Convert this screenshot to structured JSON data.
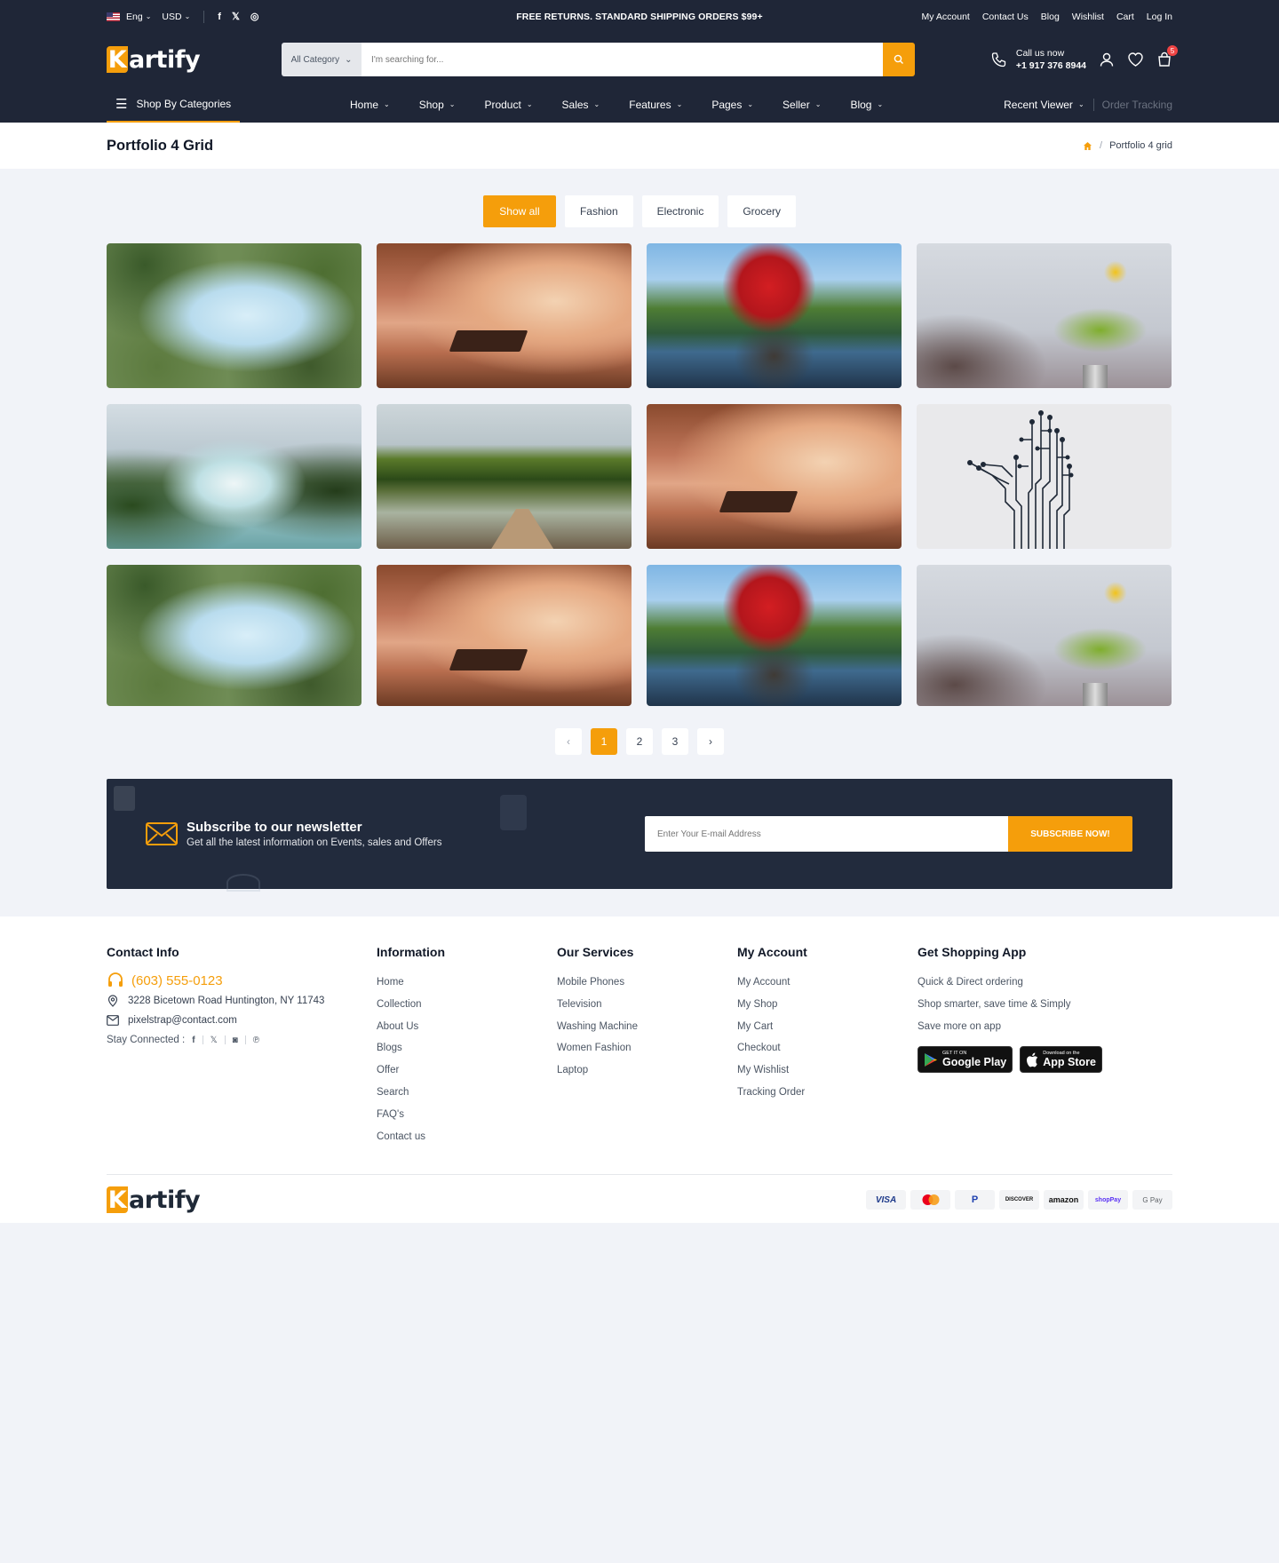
{
  "topbar": {
    "language": "Eng",
    "currency": "USD",
    "promo": "FREE RETURNS. STANDARD SHIPPING ORDERS $99+",
    "links": [
      "My Account",
      "Contact Us",
      "Blog",
      "Wishlist",
      "Cart",
      "Log In"
    ]
  },
  "header": {
    "logo_first": "K",
    "logo_rest": "artify",
    "search_category": "All Category",
    "search_placeholder": "I'm searching for...",
    "call_label": "Call us now",
    "call_number": "+1 917 376 8944",
    "cart_count": "5"
  },
  "nav": {
    "shop_by": "Shop By Categories",
    "items": [
      "Home",
      "Shop",
      "Product",
      "Sales",
      "Features",
      "Pages",
      "Seller",
      "Blog"
    ],
    "recent": "Recent Viewer",
    "tracking": "Order Tracking"
  },
  "page": {
    "title": "Portfolio 4 Grid",
    "crumb": "Portfolio 4 grid"
  },
  "filters": [
    "Show all",
    "Fashion",
    "Electronic",
    "Grocery"
  ],
  "gallery": [
    "forest-canopy",
    "misty-bench",
    "red-tree-island",
    "yellow-flower",
    "waterfall-gorge",
    "lake-pier",
    "misty-bench",
    "circuit-hand",
    "forest-canopy",
    "misty-bench",
    "red-tree-island",
    "yellow-flower"
  ],
  "pagination": [
    "1",
    "2",
    "3"
  ],
  "newsletter": {
    "title": "Subscribe to our newsletter",
    "subtitle": "Get all the latest information on Events, sales and Offers",
    "placeholder": "Enter Your E-mail Address",
    "button": "SUBSCRIBE NOW!"
  },
  "footer": {
    "contact": {
      "title": "Contact Info",
      "phone": "(603) 555-0123",
      "address": "3228 Bicetown Road Huntington, NY 11743",
      "email": "pixelstrap@contact.com",
      "stay": "Stay Connected :"
    },
    "information": {
      "title": "Information",
      "links": [
        "Home",
        "Collection",
        "About Us",
        "Blogs",
        "Offer",
        "Search",
        "FAQ's",
        "Contact us"
      ]
    },
    "services": {
      "title": "Our Services",
      "links": [
        "Mobile Phones",
        "Television",
        "Washing Machine",
        "Women Fashion",
        "Laptop"
      ]
    },
    "account": {
      "title": "My Account",
      "links": [
        "My Account",
        "My Shop",
        "My Cart",
        "Checkout",
        "My Wishlist",
        "Tracking Order"
      ]
    },
    "app": {
      "title": "Get Shopping App",
      "lines": [
        "Quick & Direct ordering",
        "Shop smarter, save time & Simply",
        "Save more on app"
      ],
      "google_small": "GET IT ON",
      "google_big": "Google Play",
      "apple_small": "Download on the",
      "apple_big": "App Store"
    },
    "payments": [
      "VISA",
      "",
      "P",
      "DISCOVER",
      "amazon",
      "shopPay",
      "G Pay"
    ]
  },
  "colors": {
    "accent": "#f59e0b",
    "dark": "#1f2637"
  }
}
